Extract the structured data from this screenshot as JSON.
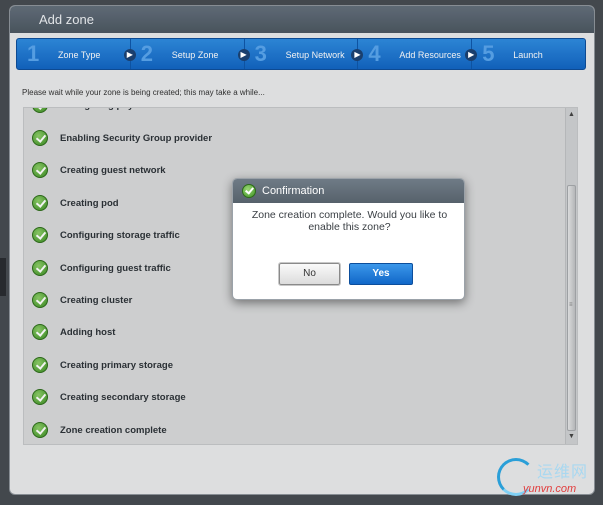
{
  "window": {
    "title": "Add zone"
  },
  "steps": [
    {
      "number": "1",
      "label": "Zone Type"
    },
    {
      "number": "2",
      "label": "Setup Zone"
    },
    {
      "number": "3",
      "label": "Setup Network"
    },
    {
      "number": "4",
      "label": "Add Resources"
    },
    {
      "number": "5",
      "label": "Launch"
    }
  ],
  "wait_text": "Please wait while your zone is being created; this may take a while...",
  "progress_items": [
    {
      "label": "Configuring physical networks",
      "icon": "check-icon"
    },
    {
      "label": "Enabling Security Group provider",
      "icon": "check-icon"
    },
    {
      "label": "Creating guest network",
      "icon": "check-icon"
    },
    {
      "label": "Creating pod",
      "icon": "check-icon"
    },
    {
      "label": "Configuring storage traffic",
      "icon": "check-icon"
    },
    {
      "label": "Configuring guest traffic",
      "icon": "check-icon"
    },
    {
      "label": "Creating cluster",
      "icon": "check-icon"
    },
    {
      "label": "Adding host",
      "icon": "check-icon"
    },
    {
      "label": "Creating primary storage",
      "icon": "check-icon"
    },
    {
      "label": "Creating secondary storage",
      "icon": "check-icon"
    },
    {
      "label": "Zone creation complete",
      "icon": "check-icon"
    }
  ],
  "dialog": {
    "title": "Confirmation",
    "message": "Zone creation complete. Would you like to enable this zone?",
    "no_label": "No",
    "yes_label": "Yes"
  },
  "watermark": {
    "cn_text": "运维网",
    "url_text": "yunvn.com"
  },
  "colors": {
    "accent": "#1a74d6",
    "success": "#3c8e24",
    "titlebar": "#56616b"
  }
}
